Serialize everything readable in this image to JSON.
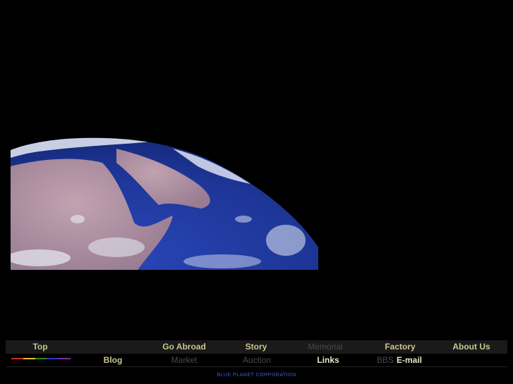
{
  "hero": {
    "image": "earth-from-space",
    "colors": {
      "ocean": "#1d3596",
      "land": "#b99aa6",
      "cloud": "#e8ecf6"
    }
  },
  "nav": {
    "row1": [
      {
        "label": "Top",
        "state": "active"
      },
      {
        "label": "Go Abroad",
        "state": "active"
      },
      {
        "label": "Story",
        "state": "active"
      },
      {
        "label": "Memorial",
        "state": "disabled"
      },
      {
        "label": "Factory",
        "state": "active"
      },
      {
        "label": "About Us",
        "state": "active"
      }
    ],
    "row2": [
      {
        "label": "Blog",
        "state": "active"
      },
      {
        "label": "Market",
        "state": "disabled"
      },
      {
        "label": "Auction",
        "state": "disabled"
      },
      {
        "label": "Links",
        "state": "current"
      },
      {
        "label": "BBS",
        "state": "disabled"
      },
      {
        "label": "E-mail",
        "state": "current"
      }
    ],
    "color_stripe": [
      "#d12a2a",
      "#e0c020",
      "#2a8a2a",
      "#2a3ad0",
      "#8a2aa0"
    ],
    "text_color": "#c9c58f",
    "disabled_color": "#4a4a4a"
  },
  "footer": {
    "text": "BLUE PLANET CORPORATION"
  }
}
